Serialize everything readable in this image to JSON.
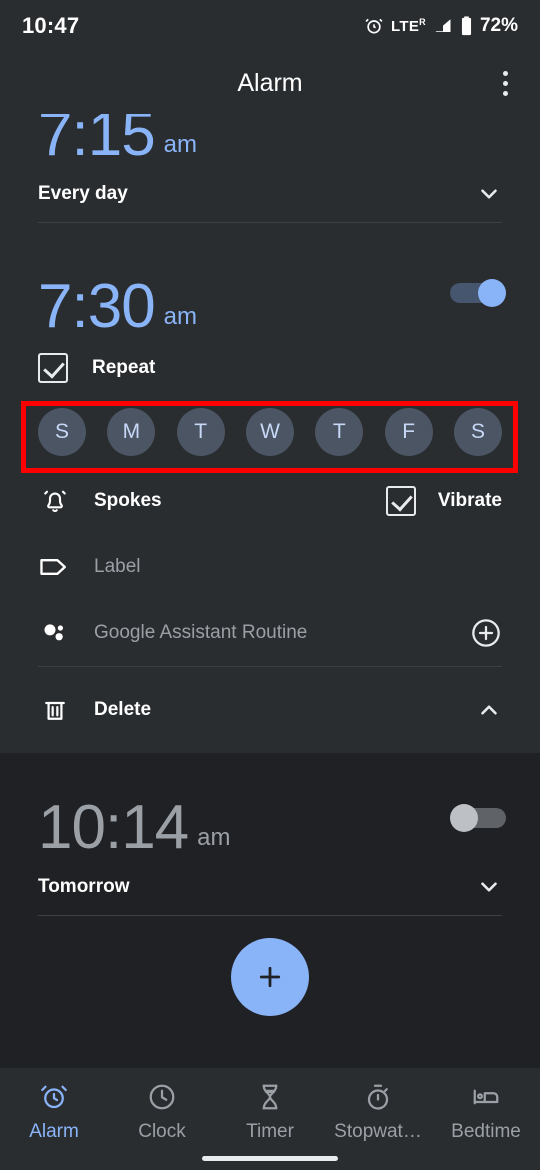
{
  "status_bar": {
    "time": "10:47",
    "network": "LTE",
    "network_sup": "R",
    "battery": "72%",
    "icons": [
      "alarm-icon",
      "signal-icon",
      "battery-icon"
    ]
  },
  "app_bar": {
    "title": "Alarm",
    "overflow_label": "More options"
  },
  "alarms": [
    {
      "time": "7:15",
      "ampm": "am",
      "enabled": true,
      "schedule": "Every day",
      "expanded": false,
      "clipped": true
    },
    {
      "time": "7:30",
      "ampm": "am",
      "enabled": true,
      "expanded": true,
      "repeat_label": "Repeat",
      "repeat_checked": true,
      "days": [
        {
          "letter": "S",
          "name": "Sunday",
          "selected": true
        },
        {
          "letter": "M",
          "name": "Monday",
          "selected": true
        },
        {
          "letter": "T",
          "name": "Tuesday",
          "selected": true
        },
        {
          "letter": "W",
          "name": "Wednesday",
          "selected": true
        },
        {
          "letter": "T",
          "name": "Thursday",
          "selected": true
        },
        {
          "letter": "F",
          "name": "Friday",
          "selected": true
        },
        {
          "letter": "S",
          "name": "Saturday",
          "selected": true
        }
      ],
      "ringtone": "Spokes",
      "vibrate_label": "Vibrate",
      "vibrate_checked": true,
      "label_placeholder": "Label",
      "assistant_routine": "Google Assistant Routine",
      "delete_label": "Delete"
    },
    {
      "time": "10:14",
      "ampm": "am",
      "enabled": false,
      "schedule": "Tomorrow",
      "expanded": false,
      "clipped": false
    }
  ],
  "fab": {
    "label": "Add alarm",
    "icon": "plus-icon",
    "color": "#8AB4F8"
  },
  "bottom_nav": [
    {
      "label": "Alarm",
      "icon": "alarm-clock-icon",
      "active": true
    },
    {
      "label": "Clock",
      "icon": "clock-icon",
      "active": false
    },
    {
      "label": "Timer",
      "icon": "hourglass-icon",
      "active": false
    },
    {
      "label": "Stopwat…",
      "icon": "stopwatch-icon",
      "active": false
    },
    {
      "label": "Bedtime",
      "icon": "bed-icon",
      "active": false
    }
  ],
  "annotation": {
    "highlight_color": "#FF0000",
    "target": "day-selector-row"
  },
  "colors": {
    "accent": "#8AB4F8",
    "card_bg": "#2A2D30",
    "page_bg": "#202124",
    "disabled_text": "#9AA0A6"
  }
}
